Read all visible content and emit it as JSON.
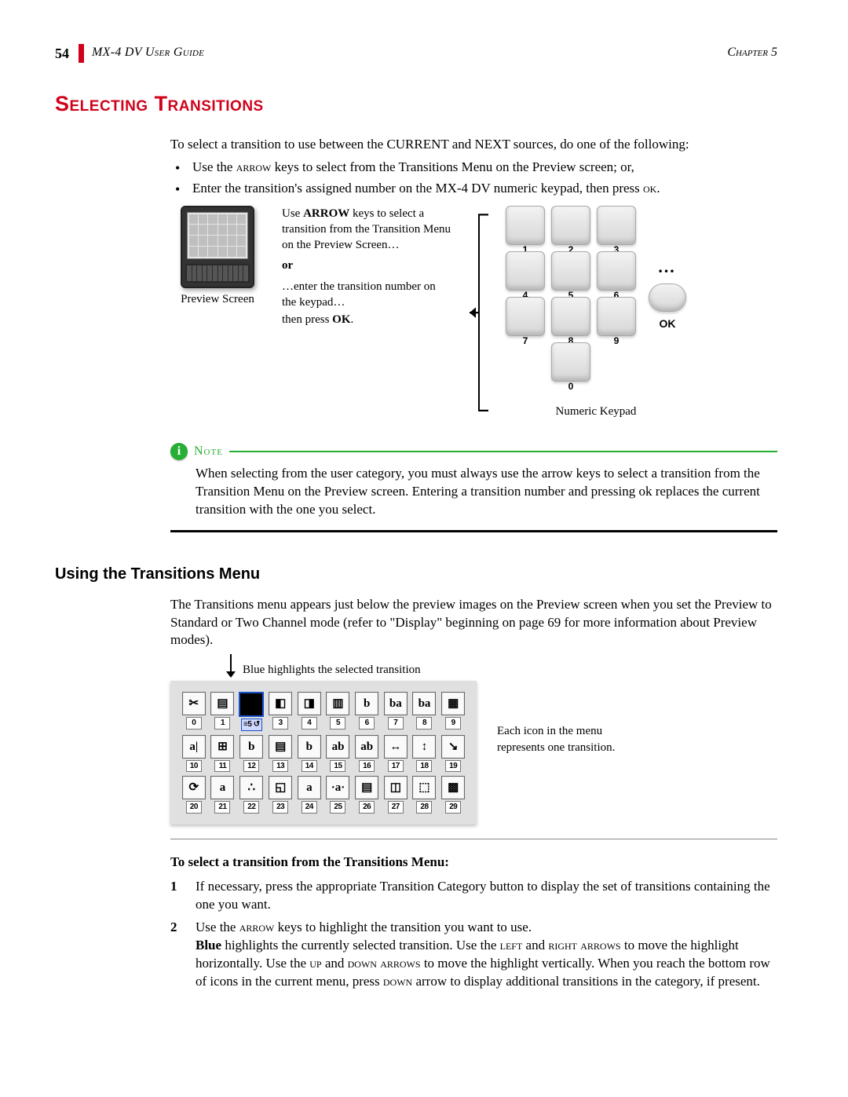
{
  "header": {
    "page_number": "54",
    "doc_title": "MX-4 DV User Guide",
    "chapter": "Chapter 5"
  },
  "h1": "Selecting Transitions",
  "intro": "To select a transition to use between the CURRENT and NEXT sources, do one of the following:",
  "bullets": {
    "b1_a": "Use the ",
    "b1_arrow": "arrow",
    "b1_b": " keys to select from the Transitions Menu on the Preview screen; or,",
    "b2_a": "Enter the transition's assigned number on the MX-4 DV numeric keypad, then press ",
    "b2_ok": "ok",
    "b2_b": "."
  },
  "fig1": {
    "monitor_caption": "Preview Screen",
    "t1a": "Use ",
    "t1_arrow": "ARROW",
    "t1b": " keys to select a transition from the Transition Menu on the Preview Screen…",
    "or": "or",
    "t2": "…enter the transition number on the keypad…",
    "t3a": "then press ",
    "t3_ok": "OK",
    "t3b": ".",
    "keypad_caption": "Numeric Keypad",
    "keys": [
      "1",
      "2",
      "3",
      "4",
      "5",
      "6",
      "7",
      "8",
      "9",
      "0"
    ],
    "ok_label": "OK",
    "ellipsis": "…"
  },
  "note": {
    "label": "Note",
    "body": "When selecting from the user category, you must always use the arrow keys to select a transition from the Transition Menu on the Preview screen. Entering a transition number and pressing ok replaces the current transition with the one you select."
  },
  "h2": "Using the Transitions Menu",
  "para2": "The Transitions menu appears just below the preview images on the Preview screen when you set the Preview to Standard or Two Channel mode (refer to \"Display\" beginning on page 69 for more information about Preview modes).",
  "fig2": {
    "top_callout": "Blue highlights the selected transition",
    "side_callout": "Each icon in the menu represents one transition.",
    "selected_index": 2,
    "cells": [
      {
        "n": "0",
        "g": "✂"
      },
      {
        "n": "1",
        "g": "▤"
      },
      {
        "n": "2",
        "g": "■",
        "sel": true,
        "badge": "≡5 ↺"
      },
      {
        "n": "3",
        "g": "◧"
      },
      {
        "n": "4",
        "g": "◨"
      },
      {
        "n": "5",
        "g": "▥"
      },
      {
        "n": "6",
        "g": "b"
      },
      {
        "n": "7",
        "g": "ba"
      },
      {
        "n": "8",
        "g": "ba"
      },
      {
        "n": "9",
        "g": "▦"
      },
      {
        "n": "10",
        "g": "a|"
      },
      {
        "n": "11",
        "g": "⊞"
      },
      {
        "n": "12",
        "g": "b"
      },
      {
        "n": "13",
        "g": "▤"
      },
      {
        "n": "14",
        "g": "b"
      },
      {
        "n": "15",
        "g": "ab"
      },
      {
        "n": "16",
        "g": "ab"
      },
      {
        "n": "17",
        "g": "↔"
      },
      {
        "n": "18",
        "g": "↕"
      },
      {
        "n": "19",
        "g": "↘"
      },
      {
        "n": "20",
        "g": "⟳"
      },
      {
        "n": "21",
        "g": "a"
      },
      {
        "n": "22",
        "g": "∴"
      },
      {
        "n": "23",
        "g": "◱"
      },
      {
        "n": "24",
        "g": "a"
      },
      {
        "n": "25",
        "g": "·a·"
      },
      {
        "n": "26",
        "g": "▤"
      },
      {
        "n": "27",
        "g": "◫"
      },
      {
        "n": "28",
        "g": "⬚"
      },
      {
        "n": "29",
        "g": "▩"
      }
    ]
  },
  "instr": {
    "title": "To select a transition from the Transitions Menu:",
    "s1_num": "1",
    "s1": "If necessary, press the appropriate Transition Category button to display the set of transitions containing the one you want.",
    "s2_num": "2",
    "s2a": "Use the ",
    "s2_arrow": "arrow",
    "s2b": " keys to highlight the transition you want to use.",
    "s2_p2_a": "Blue",
    "s2_p2_b": " highlights the currently selected transition. Use the ",
    "s2_left": "left",
    "s2_and1": " and ",
    "s2_right": "right arrows",
    "s2_p2_c": " to move the highlight horizontally. Use the ",
    "s2_up": "up",
    "s2_and2": " and ",
    "s2_down": "down arrows",
    "s2_p2_d": " to move the highlight vertically. When you reach the bottom row of icons in the current menu, press ",
    "s2_down2": "down",
    "s2_p2_e": " arrow to display additional transitions in the category, if present."
  }
}
